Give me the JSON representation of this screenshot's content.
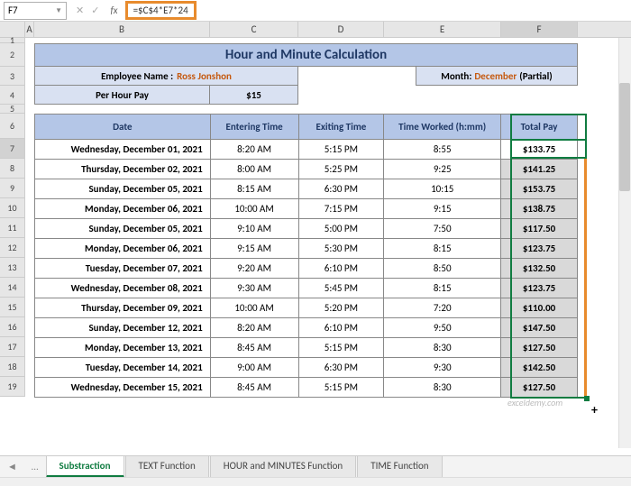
{
  "namebox": "F7",
  "formula": "=$C$4*E7*24",
  "columns": [
    "A",
    "B",
    "C",
    "D",
    "E",
    "F"
  ],
  "title": "Hour and Minute Calculation",
  "employee_label": "Employee Name :",
  "employee_name": "Ross Jonshon",
  "month_label": "Month:",
  "month_value": "December",
  "month_suffix": "(Partial)",
  "per_hour_label": "Per Hour Pay",
  "per_hour_value": "$15",
  "headers": {
    "date": "Date",
    "enter": "Entering Time",
    "exit": "Exiting Time",
    "worked": "Time Worked (h:mm)",
    "pay": "Total Pay"
  },
  "rows": [
    {
      "n": "7",
      "date": "Wednesday, December 01, 2021",
      "enter": "8:20 AM",
      "exit": "5:15 PM",
      "worked": "8:55",
      "pay": "$133.75"
    },
    {
      "n": "8",
      "date": "Thursday, December 02, 2021",
      "enter": "8:00 AM",
      "exit": "5:25 PM",
      "worked": "9:25",
      "pay": "$141.25"
    },
    {
      "n": "9",
      "date": "Sunday, December 05, 2021",
      "enter": "8:15 AM",
      "exit": "6:30 PM",
      "worked": "10:15",
      "pay": "$153.75"
    },
    {
      "n": "10",
      "date": "Monday, December 06, 2021",
      "enter": "10:00 AM",
      "exit": "7:15 PM",
      "worked": "9:15",
      "pay": "$138.75"
    },
    {
      "n": "11",
      "date": "Sunday, December 05, 2021",
      "enter": "9:10 AM",
      "exit": "5:00 PM",
      "worked": "7:50",
      "pay": "$117.50"
    },
    {
      "n": "12",
      "date": "Monday, December 06, 2021",
      "enter": "9:15 AM",
      "exit": "5:30 PM",
      "worked": "8:15",
      "pay": "$123.75"
    },
    {
      "n": "13",
      "date": "Tuesday, December 07, 2021",
      "enter": "9:20 AM",
      "exit": "6:10 PM",
      "worked": "8:50",
      "pay": "$132.50"
    },
    {
      "n": "14",
      "date": "Wednesday, December 08, 2021",
      "enter": "9:30 AM",
      "exit": "5:45 PM",
      "worked": "8:15",
      "pay": "$123.75"
    },
    {
      "n": "15",
      "date": "Thursday, December 09, 2021",
      "enter": "10:00 AM",
      "exit": "5:20 PM",
      "worked": "7:20",
      "pay": "$110.00"
    },
    {
      "n": "16",
      "date": "Sunday, December 12, 2021",
      "enter": "8:20 AM",
      "exit": "6:10 PM",
      "worked": "9:50",
      "pay": "$147.50"
    },
    {
      "n": "17",
      "date": "Monday, December 13, 2021",
      "enter": "8:45 AM",
      "exit": "5:15 PM",
      "worked": "8:30",
      "pay": "$127.50"
    },
    {
      "n": "18",
      "date": "Tuesday, December 14, 2021",
      "enter": "9:00 AM",
      "exit": "6:30 PM",
      "worked": "9:30",
      "pay": "$142.50"
    },
    {
      "n": "19",
      "date": "Wednesday, December 15, 2021",
      "enter": "8:45 AM",
      "exit": "5:15 PM",
      "worked": "8:30",
      "pay": "$127.50"
    }
  ],
  "tabs": [
    "Substraction",
    "TEXT Function",
    "HOUR and MINUTES Function",
    "TIME Function"
  ],
  "active_tab": "Substraction",
  "watermark": "exceldemy.com",
  "row_nums_top": [
    "1",
    "2",
    "3",
    "4",
    "5",
    "6"
  ]
}
